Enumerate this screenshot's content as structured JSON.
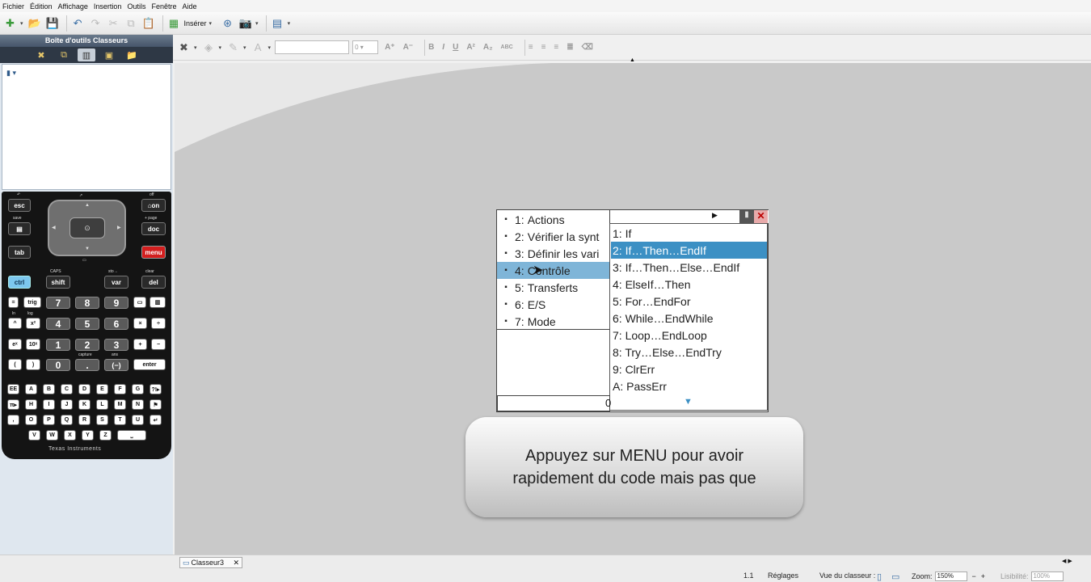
{
  "menubar": [
    "Fichier",
    "Édition",
    "Affichage",
    "Insertion",
    "Outils",
    "Fenêtre",
    "Aide"
  ],
  "toolbar": {
    "insert_label": "Insérer"
  },
  "panel": {
    "title": "Boîte d'outils Classeurs"
  },
  "calc": {
    "brand": "Texas Instruments",
    "keys": {
      "esc": "esc",
      "on": "on",
      "save_lbl": "save",
      "page_lbl": "+ page",
      "doc": "doc",
      "tab": "tab",
      "menu": "menu",
      "off_lbl": "off",
      "caps_lbl": "CAPS",
      "sto_lbl": "sto→",
      "clear_lbl": "clear",
      "ctrl": "ctrl",
      "shift": "shift",
      "var": "var",
      "del": "del",
      "eq": "=",
      "trig": "trig",
      "n7": "7",
      "n8": "8",
      "n9": "9",
      "caret": "^",
      "x2": "x²",
      "n4": "4",
      "n5": "5",
      "n6": "6",
      "mul": "×",
      "div": "÷",
      "ex": "eˣ",
      "ten": "10ˣ",
      "n1": "1",
      "n2": "2",
      "n3": "3",
      "plus": "+",
      "minus": "−",
      "lp": "(",
      "rp": ")",
      "n0": "0",
      "dot": ".",
      "neg": "(−)",
      "enter": "enter",
      "capture_lbl": "capture",
      "ans_lbl": "ans",
      "ln_lbl": "ln",
      "log_lbl": "log",
      "letters1": [
        "EE",
        "A",
        "B",
        "C",
        "D",
        "E",
        "F",
        "G",
        "?!▸"
      ],
      "letters2": [
        "π▸",
        "H",
        "I",
        "J",
        "K",
        "L",
        "M",
        "N",
        "⚑"
      ],
      "letters3": [
        ",",
        "O",
        "P",
        "Q",
        "R",
        "S",
        "T",
        "U",
        "↵"
      ],
      "letters4": [
        "V",
        "W",
        "X",
        "Y",
        "Z",
        "⎵"
      ]
    }
  },
  "screen": {
    "menu1": [
      {
        "num": "1:",
        "label": "Actions",
        "icon": "actions-icon"
      },
      {
        "num": "2:",
        "label": "Vérifier la synt",
        "icon": "check-syntax-icon"
      },
      {
        "num": "3:",
        "label": "Définir les vari",
        "icon": "define-vars-icon"
      },
      {
        "num": "4:",
        "label": "Contrôle",
        "icon": "control-icon"
      },
      {
        "num": "5:",
        "label": "Transferts",
        "icon": "transfer-icon"
      },
      {
        "num": "6:",
        "label": "E/S",
        "icon": "io-icon"
      },
      {
        "num": "7:",
        "label": "Mode",
        "icon": "mode-icon"
      }
    ],
    "menu2": [
      "1: If",
      "2: If…Then…EndIf",
      "3: If…Then…Else…EndIf",
      "4: ElseIf…Then",
      "5: For…EndFor",
      "6: While…EndWhile",
      "7: Loop…EndLoop",
      "8: Try…Else…EndTry",
      "9: ClrErr",
      "A: PassErr"
    ],
    "bottom_char": "0"
  },
  "callout": {
    "line1": "Appuyez sur MENU pour avoir",
    "line2": "rapidement du code mais pas que"
  },
  "status": {
    "tab": "Classeur3",
    "page": "1.1",
    "settings": "Réglages",
    "view_label": "Vue du classeur :",
    "zoom_label": "Zoom:",
    "zoom": "150%",
    "legibility_label": "Lisibilité:",
    "legibility": "100%"
  }
}
